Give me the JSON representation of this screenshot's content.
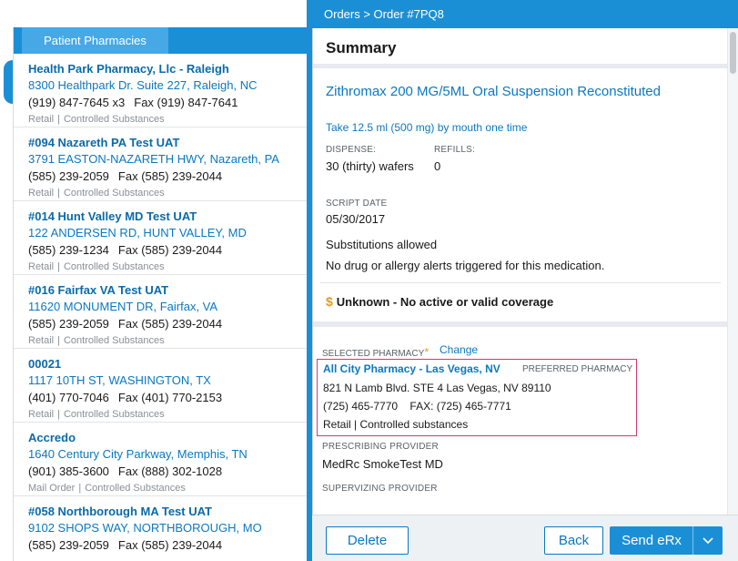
{
  "left_panel": {
    "tab_label": "Patient Pharmacies",
    "pharmacies": [
      {
        "name": "Health Park Pharmacy, Llc - Raleigh",
        "address": "8300 Healthpark Dr. Suite 227, Raleigh, NC",
        "phone": "(919) 847-7645 x3",
        "fax": "Fax (919) 847-7641",
        "type": "Retail",
        "tag": "Controlled Substances"
      },
      {
        "name": "#094 Nazareth PA Test UAT",
        "address": "3791 EASTON-NAZARETH HWY, Nazareth, PA",
        "phone": "(585) 239-2059",
        "fax": "Fax (585) 239-2044",
        "type": "Retail",
        "tag": "Controlled Substances"
      },
      {
        "name": "#014 Hunt Valley MD Test UAT",
        "address": "122 ANDERSEN RD, HUNT VALLEY, MD",
        "phone": "(585) 239-1234",
        "fax": "Fax (585) 239-2044",
        "type": "Retail",
        "tag": "Controlled Substances"
      },
      {
        "name": "#016 Fairfax VA Test UAT",
        "address": "11620 MONUMENT DR, Fairfax, VA",
        "phone": "(585) 239-2059",
        "fax": "Fax (585) 239-2044",
        "type": "Retail",
        "tag": "Controlled Substances"
      },
      {
        "name": "00021",
        "address": "1117 10TH ST, WASHINGTON, TX",
        "phone": "(401) 770-7046",
        "fax": "Fax (401) 770-2153",
        "type": "Retail",
        "tag": "Controlled Substances"
      },
      {
        "name": "Accredo",
        "address": "1640 Century City Parkway, Memphis, TN",
        "phone": "(901) 385-3600",
        "fax": "Fax (888) 302-1028",
        "type": "Mail Order",
        "tag": "Controlled Substances"
      },
      {
        "name": "#058 Northborough MA Test UAT",
        "address": "9102 SHOPS WAY, NORTHBOROUGH, MO",
        "phone": "(585) 239-2059",
        "fax": "Fax (585) 239-2044",
        "type": "",
        "tag": ""
      }
    ]
  },
  "right_panel": {
    "breadcrumb": "Orders > Order #7PQ8",
    "summary_title": "Summary",
    "medication": {
      "name": "Zithromax 200 MG/5ML Oral Suspension Reconstituted",
      "sig": "Take 12.5 ml (500 mg) by mouth one time",
      "dispense_label": "DISPENSE:",
      "dispense_value": "30 (thirty) wafers",
      "refills_label": "REFILLS:",
      "refills_value": "0",
      "script_date_label": "SCRIPT DATE",
      "script_date_value": "05/30/2017",
      "substitutions": "Substitutions allowed",
      "alerts": "No drug or allergy alerts triggered for this medication.",
      "coverage_symbol": "$",
      "coverage": "Unknown - No active or valid coverage"
    },
    "selected_pharmacy": {
      "label": "SELECTED PHARMACY",
      "required_mark": "*",
      "change_label": "Change",
      "name": "All City  Pharmacy - Las Vegas, NV",
      "preferred_label": "PREFERRED PHARMACY",
      "address": "821 N Lamb Blvd. STE 4 Las Vegas, NV 89110",
      "phones": "(725) 465-7770    FAX: (725) 465-7771",
      "types": "Retail | Controlled substances"
    },
    "prescribing_provider_label": "PRESCRIBING PROVIDER",
    "prescribing_provider_value": "MedRc SmokeTest MD",
    "supervising_provider_label": "SUPERVIZING PROVIDER",
    "footer": {
      "delete_label": "Delete",
      "back_label": "Back",
      "send_label": "Send eRx"
    }
  },
  "colors": {
    "brand_blue": "#1b8fd6",
    "tab_blue": "#47a8e6",
    "link_blue": "#0a78c2",
    "highlight_border": "#d53a6a",
    "coverage_orange": "#e59a22"
  }
}
